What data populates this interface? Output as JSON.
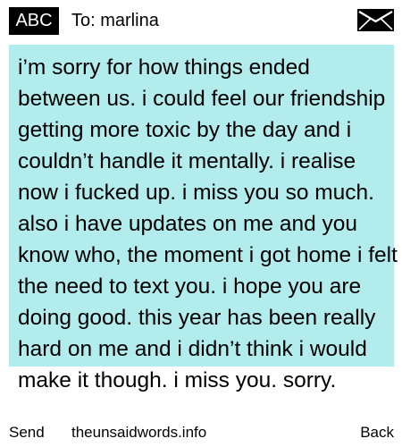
{
  "header": {
    "input_mode": "ABC",
    "recipient_label": "To: marlina",
    "icon": "envelope-icon"
  },
  "message": {
    "body": "i’m sorry for how things ended between us. i could feel our friendship getting more toxic by the day and i couldn’t handle it mentally. i realise now i fucked up. i miss you so much. also  i have updates on me and you know who, the moment i got home i felt the need to text you. i hope you are doing good. this year has been really hard on me and i didn’t think i would make it though. i miss you. sorry."
  },
  "footer": {
    "left_softkey": "Send",
    "site": "theunsaidwords.info",
    "right_softkey": "Back"
  },
  "colors": {
    "message_background": "#b2eced",
    "badge_background": "#000000",
    "page_background": "#ffffff"
  }
}
